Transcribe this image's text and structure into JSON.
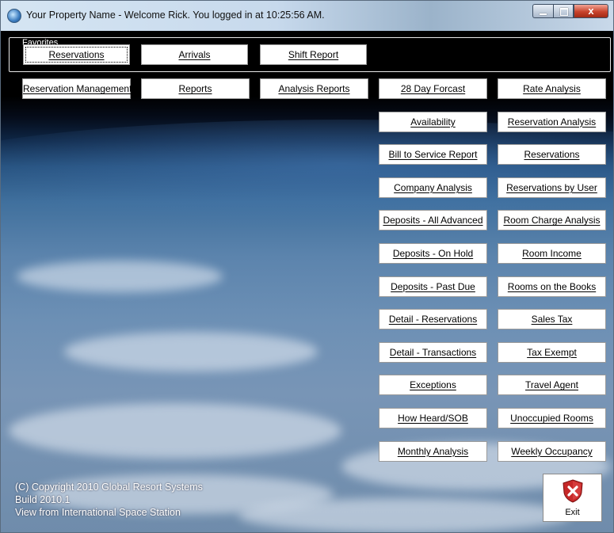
{
  "window": {
    "title": "Your Property Name - Welcome Rick.  You logged in at 10:25:56 AM.",
    "close_glyph": "x"
  },
  "favorites": {
    "legend": "Favorites",
    "buttons": [
      "Reservations",
      "Arrivals",
      "Shift Report"
    ]
  },
  "menu": {
    "buttons": [
      "Reservation Management",
      "Reports",
      "Analysis Reports"
    ]
  },
  "reports": {
    "left_column": [
      "28 Day Forcast",
      "Availability",
      "Bill to Service Report",
      "Company Analysis",
      "Deposits - All Advanced",
      "Deposits - On Hold",
      "Deposits - Past Due",
      "Detail - Reservations",
      "Detail - Transactions",
      "Exceptions",
      "How Heard/SOB",
      "Monthly Analysis"
    ],
    "right_column": [
      "Rate Analysis",
      "Reservation Analysis",
      "Reservations",
      "Reservations by User",
      "Room Charge Analysis",
      "Room Income",
      "Rooms on the Books",
      "Sales Tax",
      "Tax Exempt",
      "Travel Agent",
      "Unoccupied Rooms",
      "Weekly Occupancy"
    ]
  },
  "footer": {
    "copyright": "(C) Copyright 2010 Global Resort Systems",
    "build": "Build 2010.1",
    "credit": "View from International Space Station"
  },
  "exit": {
    "label": "Exit",
    "icon": "shield-x-icon"
  },
  "colors": {
    "exit_red": "#c62828",
    "close_red": "#c8432c"
  }
}
